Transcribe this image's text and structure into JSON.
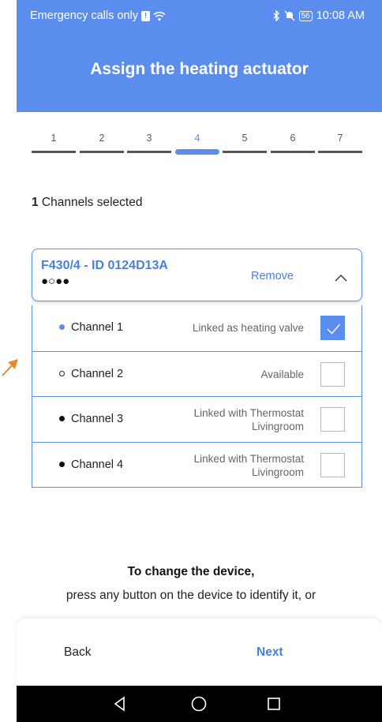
{
  "status_bar": {
    "left_text": "Emergency calls only",
    "sim_icon": "sim-warning-icon",
    "sim_glyph": "!",
    "wifi_icon": "wifi-icon",
    "bluetooth_icon": "bluetooth-icon",
    "mute_icon": "mute-icon",
    "battery_level": "56",
    "time": "10:08 AM"
  },
  "header": {
    "title": "Assign the heating actuator"
  },
  "stepper": {
    "steps": [
      "1",
      "2",
      "3",
      "4",
      "5",
      "6",
      "7"
    ],
    "active_step": "4"
  },
  "selection": {
    "count": "1",
    "label": " Channels selected"
  },
  "device": {
    "name": "F430/4 - ID 0124D13A",
    "channel_dots": "●○●●",
    "remove_label": "Remove",
    "chevron_icon": "chevron-up-icon"
  },
  "channels": [
    {
      "label": "Channel 1",
      "status": "Linked as heating valve",
      "checked": true,
      "dot": "blue"
    },
    {
      "label": "Channel 2",
      "status": "Available",
      "checked": false,
      "dot": "hollow"
    },
    {
      "label": "Channel 3",
      "status_line1": "Linked with Thermostat",
      "status_line2": "Livingroom",
      "checked": false,
      "dot": "black"
    },
    {
      "label": "Channel 4",
      "status_line1": "Linked with Thermostat",
      "status_line2": "Livingroom",
      "checked": false,
      "dot": "black"
    }
  ],
  "instructions": {
    "title": "To change the device,",
    "text": "press any button on the device to identify it, or"
  },
  "footer": {
    "back_label": "Back",
    "next_label": "Next"
  },
  "nav": {
    "back_icon": "triangle-back-icon",
    "home_icon": "circle-home-icon",
    "recents_icon": "square-recents-icon"
  },
  "colors": {
    "accent": "#5b8def",
    "annotation_arrow": "#e8892c"
  }
}
